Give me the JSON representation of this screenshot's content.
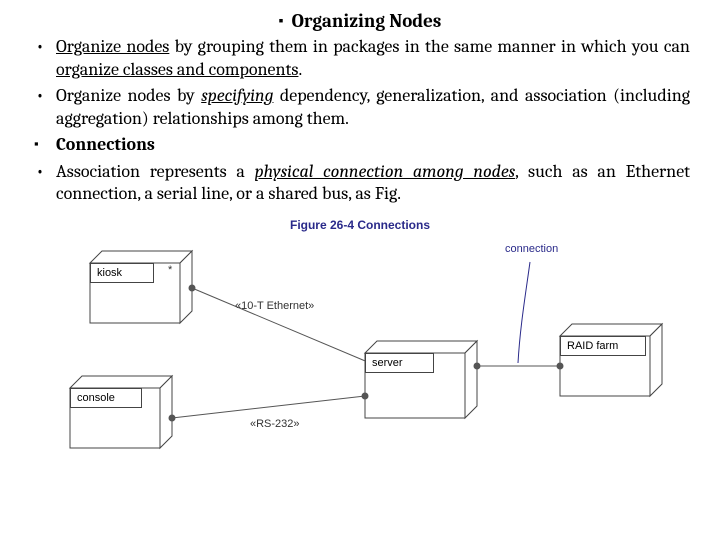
{
  "title": "Organizing Nodes",
  "bullets": [
    {
      "style": "dot",
      "html": "<span class='u'>Organize nodes</span> by grouping them in packages in the same manner in which you can <span class='u'>organize classes and components</span>."
    },
    {
      "style": "dot",
      "html": "Organize nodes by <span class='u i'>specifying</span> dependency, generalization, and association (including aggregation) relationships among them."
    },
    {
      "style": "sq",
      "html": "<span class='b'>Connections</span>"
    },
    {
      "style": "dot",
      "html": "Association represents a <span class='u i'>physical connection among nodes</span>, such as an Ethernet connection, a serial line, or a shared bus, as Fig."
    }
  ],
  "figure": {
    "caption": "Figure 26-4 Connections",
    "nodes": {
      "kiosk": "kiosk",
      "console": "console",
      "server": "server",
      "raid": "RAID farm"
    },
    "edges": {
      "ethernet": "«10-T Ethernet»",
      "rs232": "«RS-232»"
    },
    "callout": "connection",
    "multiplicity": "*"
  }
}
